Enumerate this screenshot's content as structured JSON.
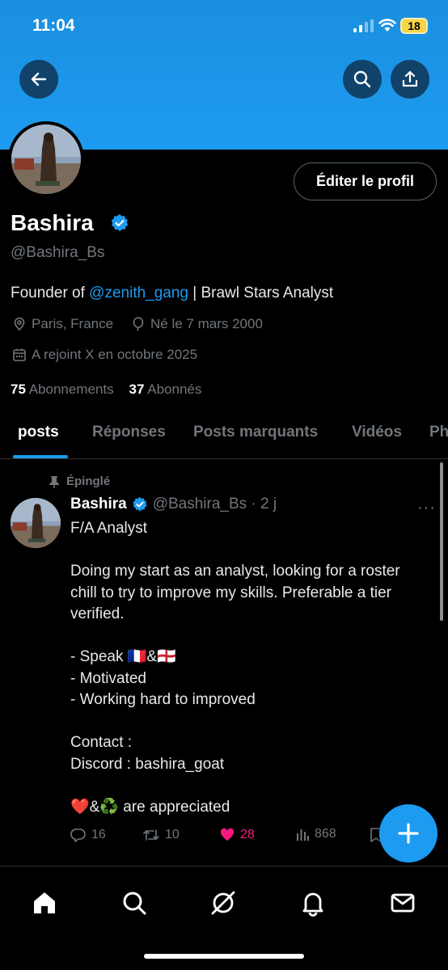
{
  "status_bar": {
    "time": "11:04",
    "battery": "18"
  },
  "profile": {
    "name": "Bashira",
    "handle": "@Bashira_Bs",
    "edit_button": "Éditer le profil",
    "bio_prefix": "Founder of ",
    "bio_mention": "@zenith_gang",
    "bio_suffix": " | Brawl Stars Analyst",
    "location": "Paris, France",
    "birthday": "Né le 7 mars 2000",
    "joined": "A rejoint X en octobre 2025",
    "following_count": "75",
    "following_label": "Abonnements",
    "followers_count": "37",
    "followers_label": "Abonnés"
  },
  "tabs": [
    "posts",
    "Réponses",
    "Posts marquants",
    "Vidéos",
    "Ph"
  ],
  "pinned_post": {
    "pinned_label": "Épinglé",
    "author": "Bashira",
    "handle_time": "@Bashira_Bs · 2 j",
    "text": "F/A Analyst\n\nDoing my start as an analyst, looking for a roster chill to try to improve my skills. Preferable a tier verified.\n\n- Speak 🇫🇷&🏴󠁧󠁢󠁥󠁮󠁧󠁿\n- Motivated\n- Working hard to improved\n\nContact :\nDiscord : bashira_goat\n\n❤️&♻️ are appreciated",
    "replies": "16",
    "reposts": "10",
    "likes": "28",
    "views": "868"
  },
  "colors": {
    "accent": "#1d9bf0",
    "like": "#f91880",
    "muted": "#71767b",
    "banner": "#1d9bf0"
  },
  "icons": {
    "nav": [
      "home-icon",
      "search-icon",
      "grok-icon",
      "bell-icon",
      "mail-icon"
    ],
    "header": [
      "back-arrow-icon",
      "search-icon",
      "share-icon"
    ]
  }
}
